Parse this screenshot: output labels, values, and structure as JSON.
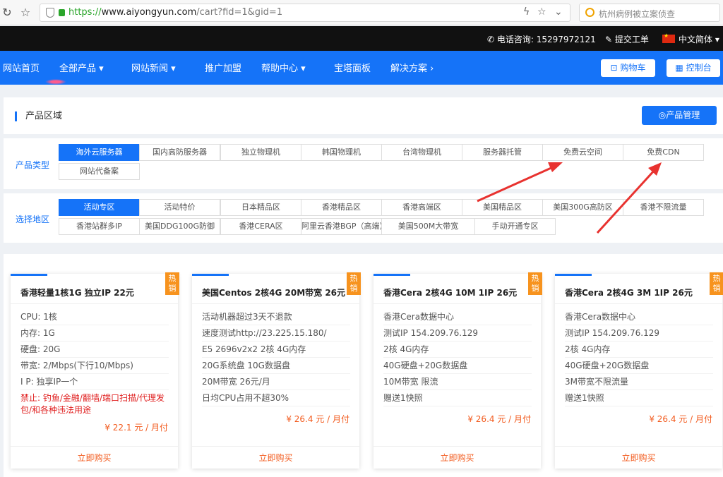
{
  "browser": {
    "url_scheme": "https://",
    "url_host": "www.aiyongyun.com",
    "url_path": "/cart?fid=1&gid=1",
    "search_text": "杭州病例被立案侦查",
    "icons": [
      "back-icon",
      "star-icon",
      "shield-icon",
      "lock-icon",
      "flash-icon",
      "bookmark-star-icon",
      "chevron-down-icon",
      "search-engine-icon"
    ]
  },
  "topbar": {
    "phone": "电话咨询: 15297972121",
    "ticket": "提交工单",
    "language": "中文简体"
  },
  "nav": {
    "items": [
      "网站首页",
      "全部产品",
      "网站新闻",
      "推广加盟",
      "帮助中心",
      "宝塔面板",
      "解决方案"
    ],
    "cart": "购物车",
    "console": "控制台"
  },
  "region_panel": {
    "title": "产品区域",
    "manage": "产品管理"
  },
  "product_type": {
    "label": "产品类型",
    "tags": [
      "海外云服务器",
      "国内高防服务器",
      "独立物理机",
      "韩国物理机",
      "台湾物理机",
      "服务器托管",
      "免费云空间",
      "免费CDN",
      "网站代备案"
    ]
  },
  "region": {
    "label": "选择地区",
    "tags": [
      "活动专区",
      "活动特价",
      "日本精品区",
      "香港精品区",
      "香港高端区",
      "美国精品区",
      "美国300G高防区",
      "香港不限流量",
      "香港站群多IP",
      "美国DDG100G防御",
      "香港CERA区",
      "阿里云香港BGP（高端）",
      "美国500M大带宽",
      "手动开通专区"
    ]
  },
  "products": [
    {
      "title": "香港轻量1核1G 独立IP 22元",
      "hot": "热销",
      "specs": [
        "CPU: 1核",
        "内存: 1G",
        "硬盘: 20G",
        "带宽: 2/Mbps(下行10/Mbps)",
        "I  P: 独享IP一个"
      ],
      "warning": "禁止: 钓鱼/金融/翻墙/端口扫描/代理发包/和各种违法用途",
      "price": "¥ 22.1 元 / 月付",
      "buy": "立即购买"
    },
    {
      "title": "美国Centos 2核4G 20M带宽 26元",
      "hot": "热销",
      "specs": [
        "活动机器超过3天不退款",
        "速度测试http://23.225.15.180/",
        "E5 2696v2x2 2核 4G内存",
        "20G系统盘 10G数据盘",
        "20M带宽 26元/月",
        "日均CPU占用不超30%"
      ],
      "price": "¥ 26.4 元 / 月付",
      "buy": "立即购买"
    },
    {
      "title": "香港Cera 2核4G 10M 1IP 26元",
      "hot": "热销",
      "specs": [
        "香港Cera数据中心",
        "测试IP 154.209.76.129",
        "2核 4G内存",
        "40G硬盘+20G数据盘",
        "10M带宽 限流",
        "赠送1快照"
      ],
      "price": "¥ 26.4 元 / 月付",
      "buy": "立即购买"
    },
    {
      "title": "香港Cera 2核4G 3M 1IP 26元",
      "hot": "热销",
      "specs": [
        "香港Cera数据中心",
        "测试IP 154.209.76.129",
        "2核 4G内存",
        "40G硬盘+20G数据盘",
        "3M带宽不限流量",
        "赠送1快照"
      ],
      "price": "¥ 26.4 元 / 月付",
      "buy": "立即购买"
    }
  ],
  "colors": {
    "brand_blue": "#1573f8",
    "price_orange": "#f25a1d",
    "hot_badge": "#f7931e",
    "annotation_red": "#e8322f"
  }
}
